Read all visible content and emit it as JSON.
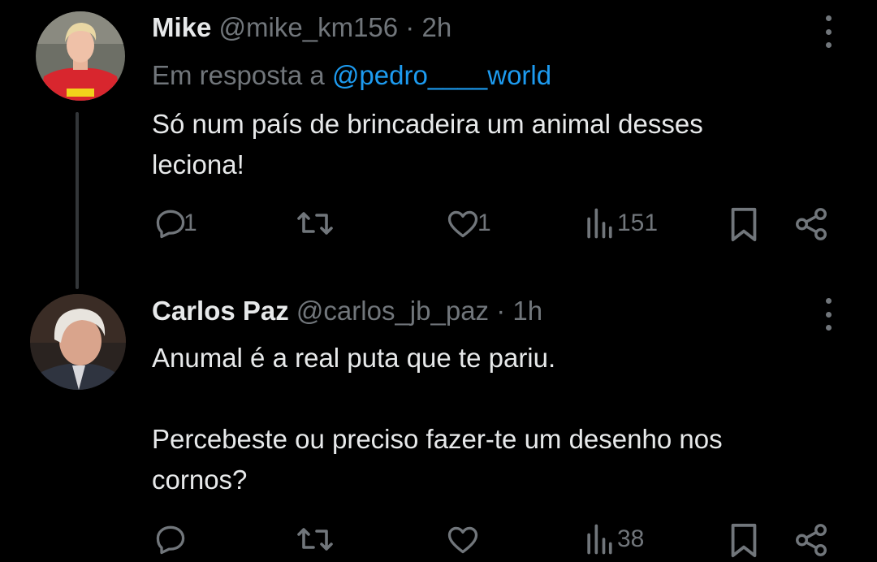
{
  "tweets": [
    {
      "name": "Mike",
      "handle": "@mike_km156",
      "separator": "·",
      "time": "2h",
      "reply_prefix": "Em resposta a",
      "reply_to": "@pedro____world",
      "body_lines": [
        "Só num país de brincadeira um animal desses",
        "leciona!"
      ],
      "replies": "1",
      "reposts": "",
      "likes": "1",
      "views": "151",
      "avatar": "player-avatar"
    },
    {
      "name": "Carlos Paz",
      "handle": "@carlos_jb_paz",
      "separator": "·",
      "time": "1h",
      "body_lines": [
        "Anumal é a real puta que te pariu.",
        "",
        "Percebeste ou preciso fazer-te um desenho nos",
        "cornos?"
      ],
      "replies": "",
      "reposts": "",
      "likes": "",
      "views": "38",
      "avatar": "man-avatar"
    }
  ],
  "colors": {
    "background": "#000000",
    "text": "#e7e9ea",
    "muted": "#71767b",
    "link": "#1d9bf0",
    "thread_line": "#333639"
  },
  "icons": [
    "reply-icon",
    "repost-icon",
    "like-icon",
    "views-icon",
    "bookmark-icon",
    "share-icon",
    "more-icon"
  ]
}
